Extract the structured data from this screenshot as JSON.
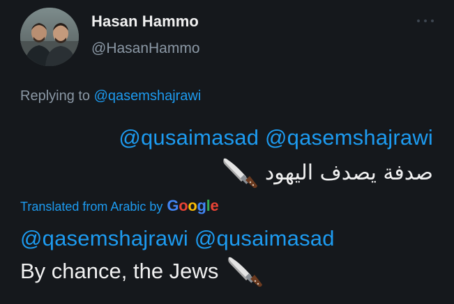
{
  "tweet": {
    "display_name": "Hasan Hammo",
    "handle": "@HasanHammo",
    "replying_prefix": "Replying to ",
    "replying_to": "@qasemshajrawi",
    "original": {
      "mention_1": "@qusaimasad",
      "mention_2": "@qasemshajrawi",
      "text": "صدفة يصدف اليهود",
      "emoji": "kitchen-knife-icon"
    },
    "translation": {
      "label": "Translated from Arabic by",
      "provider": "Google",
      "provider_letters": [
        "G",
        "o",
        "o",
        "g",
        "l",
        "e"
      ],
      "provider_colors": [
        "#4285F4",
        "#EA4335",
        "#FBBC05",
        "#4285F4",
        "#34A853",
        "#EA4335"
      ],
      "mention_1": "@qasemshajrawi",
      "mention_2": "@qusaimasad",
      "text": "By chance, the Jews",
      "emoji": "kitchen-knife-icon"
    }
  },
  "colors": {
    "background": "#15181c",
    "link": "#1d9bf0",
    "secondary_text": "#8b98a5",
    "primary_text": "#f1f1f1"
  },
  "icons": {
    "more": "more-options-icon",
    "knife": "kitchen-knife-icon"
  }
}
